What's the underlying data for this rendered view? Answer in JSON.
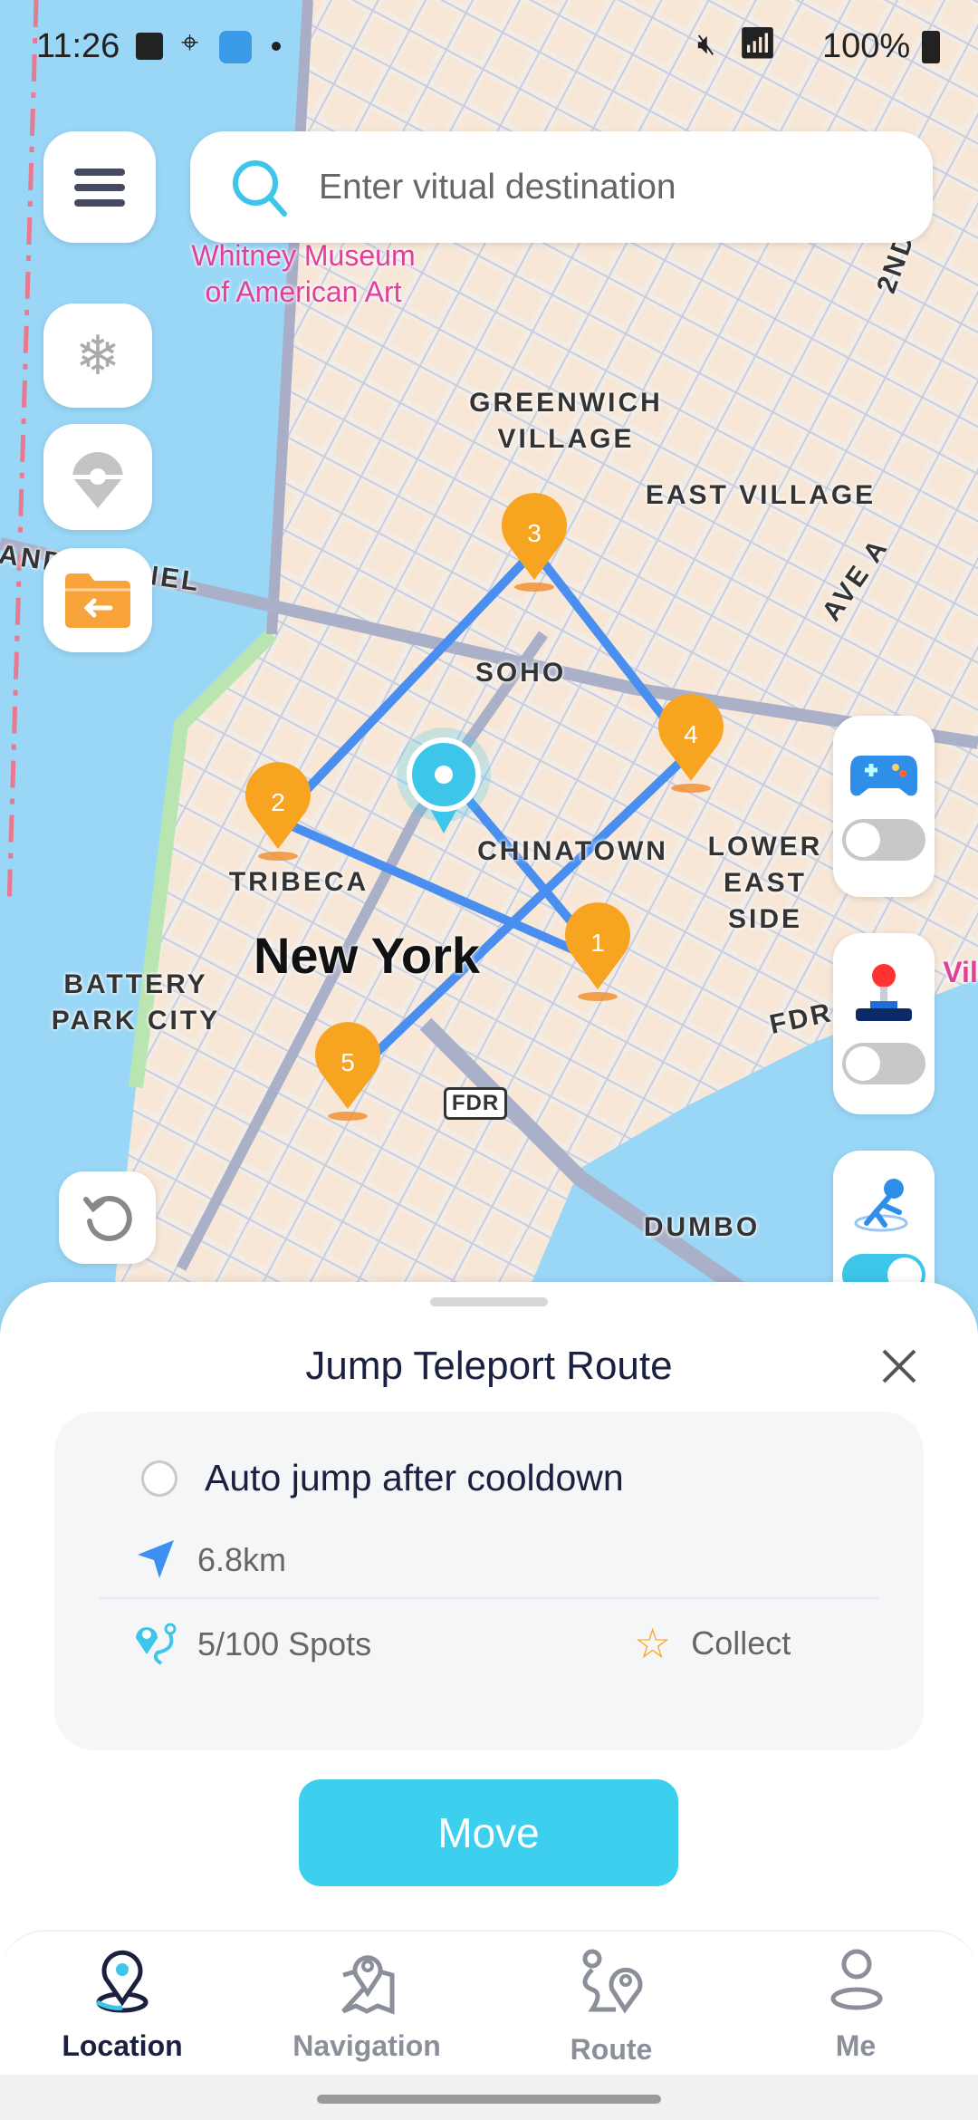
{
  "status_bar": {
    "time": "11:26",
    "battery": "100%"
  },
  "search": {
    "placeholder": "Enter vitual destination"
  },
  "map": {
    "labels": {
      "whitney_1": "Whitney Museum",
      "whitney_2": "of American Art",
      "greenwich_1": "GREENWICH",
      "greenwich_2": "VILLAGE",
      "east_village": "EAST VILLAGE",
      "soho": "SOHO",
      "chinatown": "CHINATOWN",
      "lower_east_1": "LOWER",
      "lower_east_2": "EAST SIDE",
      "tribeca": "TRIBECA",
      "new_york": "New York",
      "battery_1": "BATTERY",
      "battery_2": "PARK CITY",
      "fdr_badge": "FDR",
      "fdr_road": "FDR",
      "dumbo": "DUMBO",
      "tunnel": "AND TUNNEL",
      "second_ave": "2ND",
      "ave_a": "AVE A",
      "vill": "Vill"
    },
    "pins": [
      {
        "label": "1"
      },
      {
        "label": "2"
      },
      {
        "label": "3"
      },
      {
        "label": "4"
      },
      {
        "label": "5"
      }
    ],
    "route_color": "#4a8ff0",
    "pin_color": "#f7a521",
    "location_color": "#3dc6ea"
  },
  "left_tools": [
    "snowflake-icon",
    "pokeball-pin-icon",
    "folder-back-icon",
    "refresh-icon"
  ],
  "right_tools": [
    {
      "icon": "gamepad-icon",
      "toggle_on": false
    },
    {
      "icon": "joystick-icon",
      "toggle_on": false
    },
    {
      "icon": "running-teleport-icon",
      "toggle_on": true
    }
  ],
  "sheet": {
    "title": "Jump Teleport Route",
    "auto_jump_label": "Auto jump after cooldown",
    "auto_jump_checked": false,
    "distance": "6.8km",
    "spots": "5/100 Spots",
    "collect": "Collect",
    "move_button": "Move",
    "accent": "#3dd0ee"
  },
  "bottom_nav": {
    "items": [
      {
        "label": "Location",
        "active": true
      },
      {
        "label": "Navigation",
        "active": false
      },
      {
        "label": "Route",
        "active": false
      },
      {
        "label": "Me",
        "active": false
      }
    ]
  }
}
